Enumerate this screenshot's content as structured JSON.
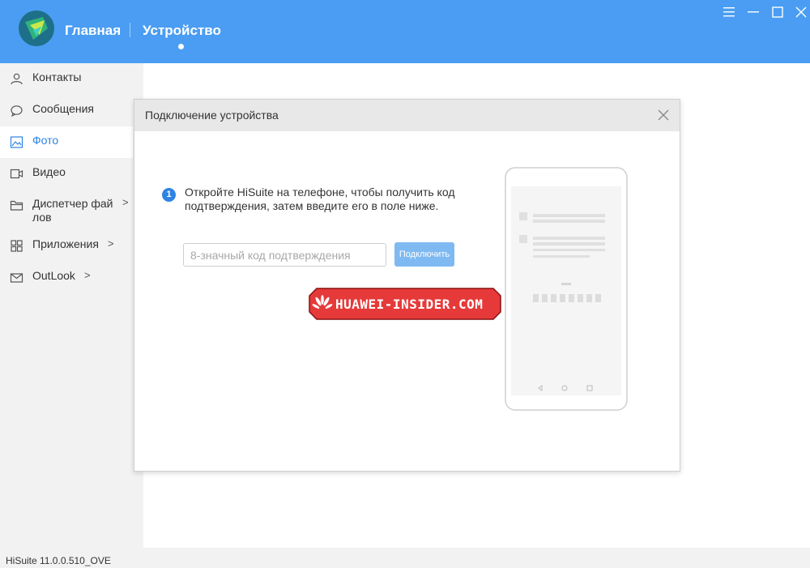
{
  "header": {
    "tab_main": "Главная",
    "tab_device": "Устройство"
  },
  "window_controls": [
    "menu-icon",
    "minimize-icon",
    "maximize-icon",
    "close-icon"
  ],
  "sidebar": {
    "items": [
      {
        "label": "Контакты",
        "icon": "contact-icon",
        "active": false
      },
      {
        "label": "Сообщения",
        "icon": "message-icon",
        "active": false
      },
      {
        "label": "Фото",
        "icon": "photo-icon",
        "active": true
      },
      {
        "label": "Видео",
        "icon": "video-icon",
        "active": false
      },
      {
        "label": "Диспетчер фай\nлов",
        "icon": "folder-icon",
        "active": false,
        "chevron": true
      },
      {
        "label": "Приложения",
        "icon": "apps-icon",
        "active": false,
        "chevron": true
      },
      {
        "label": "OutLook",
        "icon": "mail-icon",
        "active": false,
        "chevron": true
      }
    ]
  },
  "dialog": {
    "title": "Подключение устройства",
    "step_number": "1",
    "step_text": "Откройте HiSuite на телефоне, чтобы получить код подтверждения, затем введите его в поле ниже.",
    "code_placeholder": "8-значный код подтверждения",
    "code_value": "",
    "connect_label": "Подключить"
  },
  "watermark": {
    "text": "HUAWEI-INSIDER.COM"
  },
  "statusbar": {
    "version": "HiSuite 11.0.0.510_OVE"
  },
  "colors": {
    "header": "#4a9df2",
    "accent": "#2f84e3",
    "button_disabled": "#7fb9f2",
    "watermark_red": "#e63a3a"
  }
}
